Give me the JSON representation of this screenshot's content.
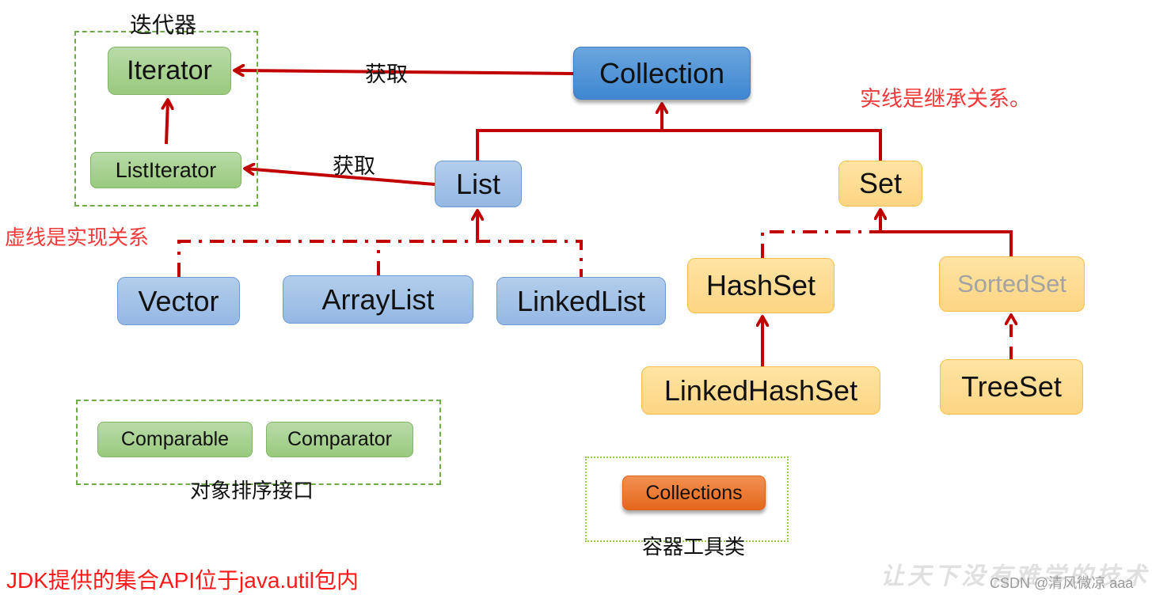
{
  "groups": {
    "iterator": {
      "label": "迭代器"
    },
    "sorting": {
      "label": "对象排序接口"
    },
    "tools": {
      "label": "容器工具类"
    }
  },
  "nodes": {
    "iterator": {
      "label": "Iterator",
      "kind": "interface"
    },
    "list_iterator": {
      "label": "ListIterator",
      "kind": "interface"
    },
    "collection": {
      "label": "Collection",
      "kind": "interface"
    },
    "list": {
      "label": "List",
      "kind": "interface"
    },
    "set": {
      "label": "Set",
      "kind": "interface"
    },
    "vector": {
      "label": "Vector",
      "kind": "class"
    },
    "array_list": {
      "label": "ArrayList",
      "kind": "class"
    },
    "linked_list": {
      "label": "LinkedList",
      "kind": "class"
    },
    "hash_set": {
      "label": "HashSet",
      "kind": "class"
    },
    "sorted_set": {
      "label": "SortedSet",
      "kind": "interface",
      "faded": true
    },
    "linked_hash_set": {
      "label": "LinkedHashSet",
      "kind": "class"
    },
    "tree_set": {
      "label": "TreeSet",
      "kind": "class"
    },
    "comparable": {
      "label": "Comparable",
      "kind": "interface"
    },
    "comparator": {
      "label": "Comparator",
      "kind": "interface"
    },
    "collections": {
      "label": "Collections",
      "kind": "utility"
    }
  },
  "edges": [
    {
      "from": "collection",
      "to": "iterator",
      "type": "association",
      "label": "获取"
    },
    {
      "from": "list",
      "to": "list_iterator",
      "type": "association",
      "label": "获取"
    },
    {
      "from": "list_iterator",
      "to": "iterator",
      "type": "inheritance"
    },
    {
      "from": "list",
      "to": "collection",
      "type": "inheritance"
    },
    {
      "from": "set",
      "to": "collection",
      "type": "inheritance"
    },
    {
      "from": "vector",
      "to": "list",
      "type": "implementation"
    },
    {
      "from": "array_list",
      "to": "list",
      "type": "implementation"
    },
    {
      "from": "linked_list",
      "to": "list",
      "type": "implementation"
    },
    {
      "from": "hash_set",
      "to": "set",
      "type": "implementation"
    },
    {
      "from": "sorted_set",
      "to": "set",
      "type": "inheritance"
    },
    {
      "from": "linked_hash_set",
      "to": "hash_set",
      "type": "inheritance"
    },
    {
      "from": "tree_set",
      "to": "sorted_set",
      "type": "implementation"
    }
  ],
  "edge_labels": {
    "get_iterator": "获取",
    "get_list_iterator": "获取"
  },
  "notes": {
    "solid_line": "实线是继承关系。",
    "dashed_line": "虚线是实现关系"
  },
  "footer": "JDK提供的集合API位于java.util包内",
  "watermark": {
    "slogan": "让天下没有难学的技术",
    "credit": "CSDN @清风微凉 aaa"
  },
  "colors": {
    "edge": "#c00000",
    "note": "#f03a3a",
    "footer": "#ff1a1a",
    "group_border": "#70ad47"
  }
}
